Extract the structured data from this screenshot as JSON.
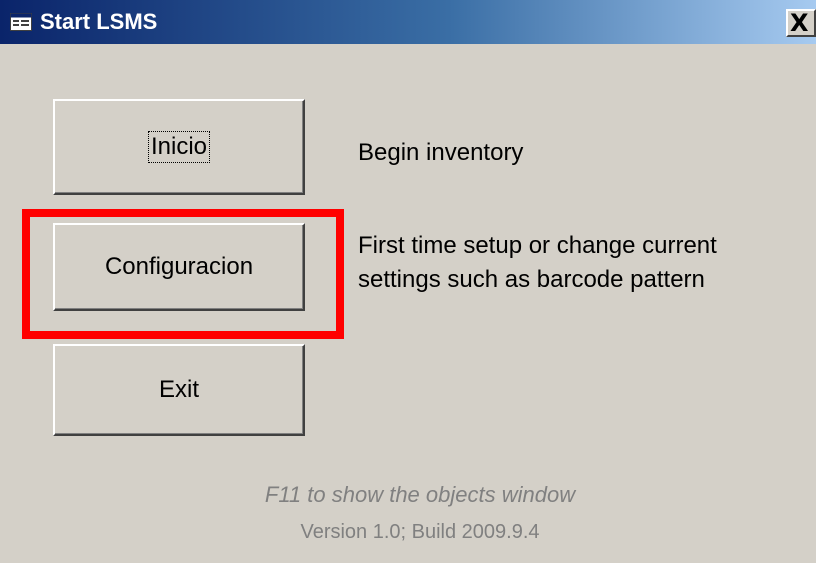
{
  "window": {
    "title": "Start LSMS",
    "close_glyph": "X",
    "icon": "form-icon"
  },
  "buttons": {
    "inicio_label": "Inicio",
    "config_label": "Configuracion",
    "exit_label": "Exit"
  },
  "descriptions": {
    "inicio": "Begin inventory",
    "config_line1": "First time setup or change current",
    "config_line2": "settings such as  barcode pattern"
  },
  "footer": {
    "hint": "F11 to show the objects window",
    "version": "Version 1.0; Build 2009.9.4"
  },
  "colors": {
    "highlight": "#ff0000",
    "window_bg": "#d4d0c8",
    "title_start": "#0a246a",
    "title_end": "#a6caf0",
    "footer_text": "#808080"
  }
}
